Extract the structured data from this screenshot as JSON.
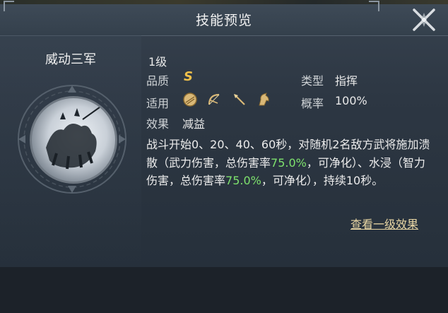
{
  "window": {
    "title": "技能预览"
  },
  "skill": {
    "name": "威动三军",
    "level": "1级",
    "quality_label": "品质",
    "quality_value": "S",
    "type_label": "类型",
    "type_value": "指挥",
    "applicable_label": "适用",
    "applicable_icons": [
      "shield-icon",
      "bow-icon",
      "spear-icon",
      "horse-icon"
    ],
    "chance_label": "概率",
    "chance_value": "100%",
    "effect_label": "效果",
    "effect_value": "减益",
    "description": {
      "part1": "战斗开始0、20、40、60秒，对随机2名敌方武将施加溃散（武力伤害，总伤害率",
      "pct1": "75.0%",
      "part2": "，可净化）、水浸（智力伤害，总伤害率",
      "pct2": "75.0%",
      "part3": "，可净化），持续10秒。"
    },
    "link": "查看一级效果"
  },
  "colors": {
    "highlight": "#7ee26d",
    "grade": "#f0c04a",
    "link": "#e8d6a4"
  }
}
